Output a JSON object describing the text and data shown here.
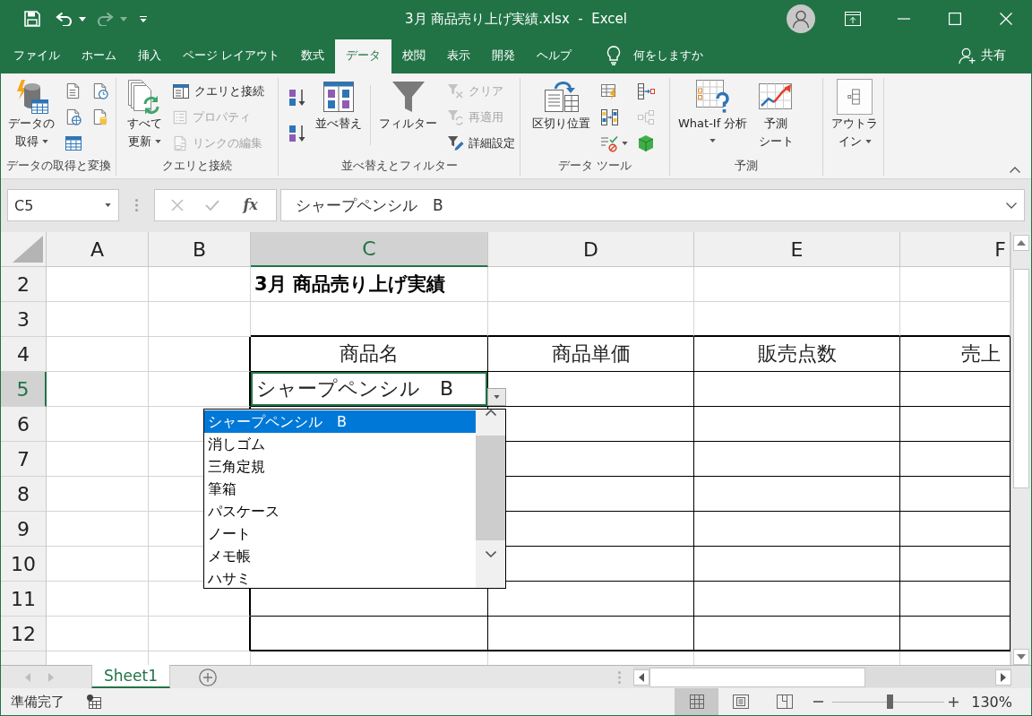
{
  "title_bar": {
    "quick_access": [
      {
        "disabled": false
      },
      {
        "disabled": false,
        "dropdown": true
      },
      {
        "disabled": true,
        "dropdown": true
      },
      {
        "disabled": false
      }
    ],
    "title": "3月 商品売り上げ実績.xlsx  -  Excel"
  },
  "tabs": [
    {
      "label": "ファイル",
      "selected": false
    },
    {
      "label": "ホーム",
      "selected": false
    },
    {
      "label": "挿入",
      "selected": false
    },
    {
      "label": "ページ レイアウト",
      "selected": false
    },
    {
      "label": "数式",
      "selected": false
    },
    {
      "label": "データ",
      "selected": true
    },
    {
      "label": "校閲",
      "selected": false
    },
    {
      "label": "表示",
      "selected": false
    },
    {
      "label": "開発",
      "selected": false
    },
    {
      "label": "ヘルプ",
      "selected": false
    }
  ],
  "tell_me": "何をしますか",
  "share": "共有",
  "ribbon": {
    "groups": [
      {
        "label": "データの取得と変換",
        "columns": [
          {
            "kind": "large",
            "buttons": [
              {
                "lines": [
                  "データの",
                  "取得"
                ],
                "dropdown": true,
                "disabled": false
              }
            ]
          },
          {
            "kind": "icons",
            "buttons": [
              {
                "disabled": false
              },
              {
                "disabled": false
              },
              {
                "disabled": false
              }
            ]
          },
          {
            "kind": "icons",
            "buttons": [
              {
                "disabled": false
              },
              {
                "disabled": false
              }
            ]
          }
        ]
      },
      {
        "label": "クエリと接続",
        "columns": [
          {
            "kind": "large",
            "buttons": [
              {
                "lines": [
                  "すべて",
                  "更新"
                ],
                "dropdown": true,
                "disabled": false
              }
            ]
          },
          {
            "kind": "small",
            "buttons": [
              {
                "label": "クエリと接続",
                "disabled": false
              },
              {
                "label": "プロパティ",
                "disabled": true
              },
              {
                "label": "リンクの編集",
                "disabled": true
              }
            ]
          }
        ]
      },
      {
        "label": "並べ替えとフィルター",
        "columns": [
          {
            "kind": "sort",
            "buttons": [
              {
                "disabled": false
              },
              {
                "disabled": false
              }
            ]
          },
          {
            "kind": "large",
            "buttons": [
              {
                "lines": [
                  "並べ替え"
                ],
                "disabled": false
              }
            ]
          },
          {
            "kind": "separator"
          },
          {
            "kind": "large",
            "buttons": [
              {
                "lines": [
                  "フィルター"
                ],
                "disabled": false
              }
            ]
          },
          {
            "kind": "small",
            "buttons": [
              {
                "label": "クリア",
                "disabled": true
              },
              {
                "label": "再適用",
                "disabled": true
              },
              {
                "label": "詳細設定",
                "disabled": false
              }
            ]
          }
        ]
      },
      {
        "label": "データ ツール",
        "columns": [
          {
            "kind": "large",
            "buttons": [
              {
                "lines": [
                  "区切り位置"
                ],
                "disabled": false
              }
            ]
          },
          {
            "kind": "icons",
            "buttons": [
              {
                "disabled": false
              },
              {
                "disabled": false
              },
              {
                "disabled": false,
                "dropdown": true
              }
            ]
          },
          {
            "kind": "icons",
            "buttons": [
              {
                "disabled": false
              },
              {
                "disabled": true
              },
              {
                "disabled": false
              }
            ]
          }
        ]
      },
      {
        "label": "予測",
        "columns": [
          {
            "kind": "large",
            "buttons": [
              {
                "lines": [
                  "What-If 分析"
                ],
                "dropdown": true,
                "disabled": false
              }
            ]
          },
          {
            "kind": "large",
            "buttons": [
              {
                "lines": [
                  "予測",
                  "シート"
                ],
                "disabled": false
              }
            ]
          }
        ]
      },
      {
        "columns": [
          {
            "kind": "boxed",
            "buttons": [
              {
                "lines": [
                  "アウトラ",
                  "イン"
                ],
                "dropdown": true,
                "disabled": false
              }
            ]
          }
        ]
      }
    ]
  },
  "formula_bar": {
    "name_box": "C5",
    "edit_buttons": [
      {
        "disabled": true
      },
      {
        "disabled": true
      }
    ],
    "function_label": "fx",
    "content": "シャープペンシル　B"
  },
  "sheet": {
    "columns": [
      {
        "label": "A",
        "selected": false
      },
      {
        "label": "B",
        "selected": false
      },
      {
        "label": "C",
        "selected": true
      },
      {
        "label": "D",
        "selected": false
      },
      {
        "label": "E",
        "selected": false
      },
      {
        "label": "F",
        "selected": false
      }
    ],
    "rows": [
      {
        "label": "2",
        "selected": false
      },
      {
        "label": "3",
        "selected": false
      },
      {
        "label": "4",
        "selected": false
      },
      {
        "label": "5",
        "selected": true
      },
      {
        "label": "6",
        "selected": false
      },
      {
        "label": "7",
        "selected": false
      },
      {
        "label": "8",
        "selected": false
      },
      {
        "label": "9",
        "selected": false
      },
      {
        "label": "10",
        "selected": false
      },
      {
        "label": "11",
        "selected": false
      },
      {
        "label": "12",
        "selected": false
      }
    ],
    "title": "3月 商品売り上げ実績",
    "table_headers": [
      "商品名",
      "商品単価",
      "販売点数",
      "売上"
    ],
    "active_cell": {
      "value": "シャープペンシル　B",
      "list_open": true
    },
    "list_items": [
      {
        "label": "シャープペンシル　B",
        "selected": true
      },
      {
        "label": "消しゴム",
        "selected": false
      },
      {
        "label": "三角定規",
        "selected": false
      },
      {
        "label": "筆箱",
        "selected": false
      },
      {
        "label": "パスケース",
        "selected": false
      },
      {
        "label": "ノート",
        "selected": false
      },
      {
        "label": "メモ帳",
        "selected": false
      },
      {
        "label": "ハサミ",
        "selected": false
      }
    ]
  },
  "sheet_tabs": [
    {
      "label": "Sheet1",
      "selected": true
    }
  ],
  "status_bar": {
    "status": "準備完了",
    "views": [
      {
        "selected": true
      },
      {
        "selected": false
      },
      {
        "selected": false
      }
    ],
    "zoom": {
      "level": 0.51,
      "reading": "130%"
    }
  }
}
